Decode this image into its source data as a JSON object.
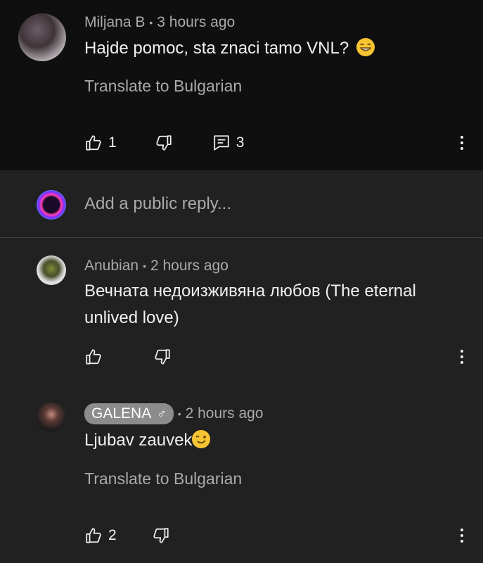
{
  "parent_comment": {
    "author": "Miljana B",
    "time": "3 hours ago",
    "text": "Hajde pomoc, sta znaci tamo VNL?",
    "translate": "Translate to Bulgarian",
    "likes": "1",
    "replies": "3"
  },
  "reply_box": {
    "placeholder": "Add a public reply..."
  },
  "replies": [
    {
      "author": "Anubian",
      "time": "2 hours ago",
      "text_line1": "Вечната недоизживяна любов (The eternal",
      "text_line2": "unlived love)"
    },
    {
      "author": "GALENA",
      "time": "2 hours ago",
      "text": "Ljubav zauvek",
      "translate": "Translate to Bulgarian",
      "likes": "2"
    }
  ],
  "icons": {
    "like": "thumb-up-icon",
    "dislike": "thumb-down-icon",
    "reply": "comment-icon",
    "more": "more-vert-icon",
    "music": "music-note-icon"
  },
  "colors": {
    "background": "#212121",
    "parent_background": "#0f0f0f",
    "meta_text": "#aaaaaa",
    "chip": "#8c8c8c"
  }
}
